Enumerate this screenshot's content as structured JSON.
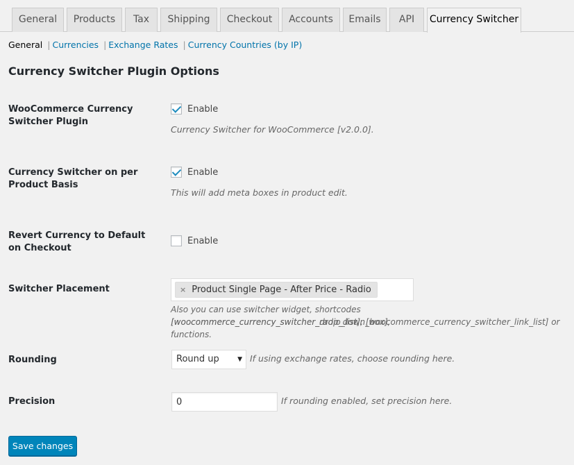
{
  "tabs": [
    {
      "label": "General"
    },
    {
      "label": "Products"
    },
    {
      "label": "Tax"
    },
    {
      "label": "Shipping"
    },
    {
      "label": "Checkout"
    },
    {
      "label": "Accounts"
    },
    {
      "label": "Emails"
    },
    {
      "label": "API"
    },
    {
      "label": "Currency Switcher",
      "active": true
    }
  ],
  "subnav": {
    "current": "General",
    "links": [
      "Currencies",
      "Exchange Rates",
      "Currency Countries (by IP)"
    ],
    "separator": "|"
  },
  "section_title": "Currency Switcher Plugin Options",
  "fields": {
    "plugin": {
      "label": "WooCommerce Currency Switcher Plugin",
      "checked": true,
      "checkbox_label": "Enable",
      "description": "Currency Switcher for WooCommerce [v2.0.0]."
    },
    "per_product": {
      "label": "Currency Switcher on per Product Basis",
      "checked": true,
      "checkbox_label": "Enable",
      "description": "This will add meta boxes in product edit."
    },
    "revert": {
      "label": "Revert Currency to Default on Checkout",
      "checked": false,
      "checkbox_label": "Enable"
    },
    "placement": {
      "label": "Switcher Placement",
      "selected_chip": "Product Single Page - After Price - Radio",
      "chip_remove": "×",
      "description_line1": "Also you can use switcher widget, shortcodes [woocommerce_currency_switcher_drop_down_box],",
      "description_line2": "[woocommerce_currency_switcher_radio_list], [woocommerce_currency_switcher_link_list] or functions."
    },
    "rounding": {
      "label": "Rounding",
      "value": "Round up",
      "description": "If using exchange rates, choose rounding here."
    },
    "precision": {
      "label": "Precision",
      "value": "0",
      "description": "If rounding enabled, set precision here."
    }
  },
  "save_button": "Save changes",
  "icons": {
    "checkmark": "check-icon",
    "dropdown_arrow": "triangle-down-icon"
  },
  "colors": {
    "primary": "#0085ba",
    "link": "#0073aa",
    "checkmark": "#1e8cbe",
    "background": "#f1f1f1"
  }
}
